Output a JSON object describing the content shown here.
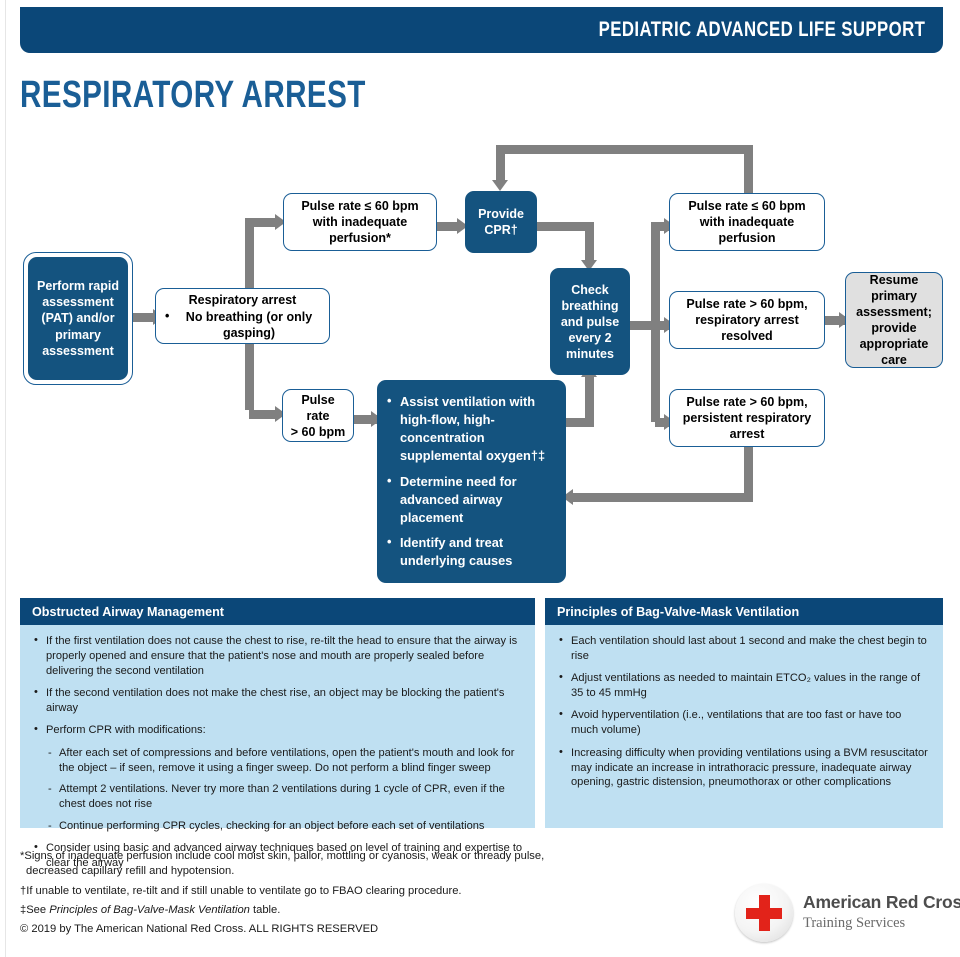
{
  "header": {
    "title": "PEDIATRIC ADVANCED LIFE SUPPORT"
  },
  "page_title": "RESPIRATORY ARREST",
  "colors": {
    "header_navy": "#0b4778",
    "box_navy": "#14537f",
    "box_border": "#1a5e96",
    "title_blue": "#1a5e96",
    "panel_body": "#bfe0f2",
    "arrow_gray": "#808080",
    "gray_box": "#e0e0e0",
    "red_cross": "#e2231a"
  },
  "flowchart": {
    "start_box": "Perform rapid assessment (PAT) and/or primary assessment",
    "respiratory_arrest": {
      "heading": "Respiratory arrest",
      "bullet": "No breathing (or only gasping)"
    },
    "branch_low_pulse": "Pulse rate ≤ 60 bpm with inadequate perfusion*",
    "branch_high_pulse": "Pulse rate\n> 60 bpm",
    "provide_cpr": "Provide CPR†",
    "check_box": "Check breathing and pulse every 2 minutes",
    "ventilation_box": {
      "items": [
        "Assist ventilation with high-flow, high-concentration supplemental oxygen†‡",
        "Determine need for advanced airway placement",
        "Identify and treat underlying causes"
      ]
    },
    "outcome_low_pulse": "Pulse rate ≤ 60 bpm with inadequate perfusion",
    "outcome_resolved": "Pulse rate > 60 bpm, respiratory arrest resolved",
    "outcome_persistent": "Pulse rate > 60 bpm, persistent respiratory arrest",
    "resume_box": "Resume primary assessment; provide appropriate care"
  },
  "panels": [
    {
      "title": "Obstructed Airway Management",
      "items": [
        {
          "level": 1,
          "text": "If the first ventilation does not cause the chest to rise, re-tilt the head to ensure that the airway is properly opened and ensure that the patient's nose and mouth are properly sealed before delivering the second ventilation"
        },
        {
          "level": 1,
          "text": "If the second ventilation does not make the chest rise, an object may be blocking the patient's airway"
        },
        {
          "level": 1,
          "text": "Perform CPR with modifications:"
        },
        {
          "level": 2,
          "text": "After each set of compressions and before ventilations, open the patient's mouth and look for the object – if seen, remove it using a finger sweep. Do not perform a blind finger sweep"
        },
        {
          "level": 2,
          "text": "Attempt 2 ventilations. Never try more than 2 ventilations during 1 cycle of CPR, even if the chest does not rise"
        },
        {
          "level": 2,
          "text": "Continue performing CPR cycles, checking for an object before each set of ventilations"
        },
        {
          "level": 1,
          "text": "Consider using basic and advanced airway techniques based on level of training and expertise to clear the airway"
        }
      ]
    },
    {
      "title": "Principles of Bag-Valve-Mask Ventilation",
      "items": [
        {
          "level": 1,
          "text": "Each ventilation should last about 1 second and make the chest begin to rise"
        },
        {
          "level": 1,
          "text": "Adjust ventilations as needed to maintain ETCO₂ values in the range of 35 to 45 mmHg"
        },
        {
          "level": 1,
          "text": "Avoid hyperventilation (i.e., ventilations that are too fast or have too much volume)"
        },
        {
          "level": 1,
          "text": "Increasing difficulty when providing ventilations using a BVM resuscitator may indicate an increase in intrathoracic pressure, inadequate airway opening, gastric distension, pneumothorax or other complications"
        }
      ]
    }
  ],
  "footnotes": {
    "line1_a": "*Signs of inadequate perfusion include cool moist skin, pallor, mottling or cyanosis, weak or thready pulse,",
    "line1_b": "decreased capillary refill and hypotension.",
    "line2": "†If unable to ventilate, re-tilt and if still unable to ventilate go to FBAO clearing procedure.",
    "line3_pre": "‡See ",
    "line3_italic": "Principles of Bag-Valve-Mask Ventilation",
    "line3_post": " table.",
    "copyright": "© 2019 by The American National Red Cross. ALL RIGHTS RESERVED"
  },
  "logo": {
    "name": "American Red Cross",
    "subtitle": "Training Services"
  }
}
